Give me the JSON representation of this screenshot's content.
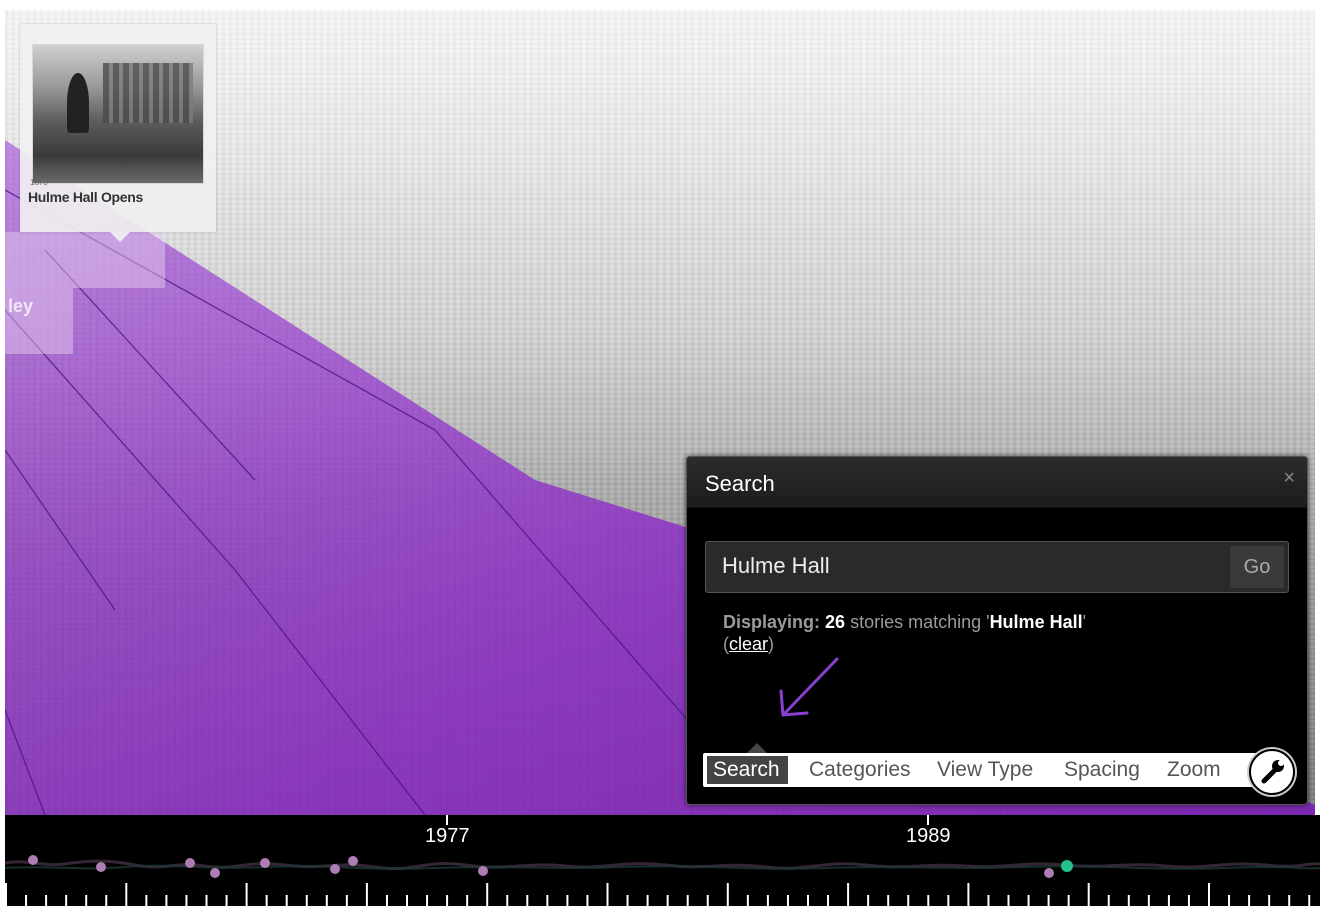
{
  "story": {
    "date": "1870",
    "title": "Hulme Hall Opens"
  },
  "ghost": {
    "text": "ley"
  },
  "search_panel": {
    "title": "Search",
    "close_icon": "×",
    "input_value": "Hulme Hall",
    "go_label": "Go",
    "result": {
      "label": "Displaying:",
      "count": "26",
      "mid": " stories matching '",
      "term": "Hulme Hall",
      "end": "'",
      "clear_open": "(",
      "clear_label": "clear",
      "clear_close": ")"
    },
    "tabs": [
      "Search",
      "Categories",
      "View Type",
      "Spacing",
      "Zoom"
    ],
    "active_tab": "Search",
    "tool_icon": "wrench-icon"
  },
  "timeline": {
    "labels": [
      "1977",
      "1989"
    ]
  },
  "colors": {
    "accent_purple": "#8a2bc4",
    "panel_bg": "#000000",
    "annotation_arrow": "#8a3fd1"
  }
}
